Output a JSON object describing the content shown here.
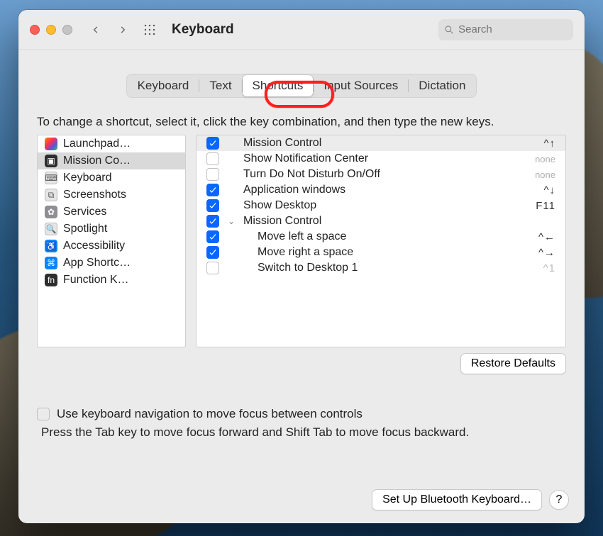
{
  "window": {
    "title": "Keyboard",
    "search_placeholder": "Search"
  },
  "tabs": [
    {
      "label": "Keyboard",
      "active": false
    },
    {
      "label": "Text",
      "active": false
    },
    {
      "label": "Shortcuts",
      "active": true,
      "highlighted": true
    },
    {
      "label": "Input Sources",
      "active": false
    },
    {
      "label": "Dictation",
      "active": false
    }
  ],
  "hint": "To change a shortcut, select it, click the key combination, and then type the new keys.",
  "categories": [
    {
      "icon": "launchpad",
      "label": "Launchpad…",
      "selected": false
    },
    {
      "icon": "mission",
      "label": "Mission Co…",
      "selected": true
    },
    {
      "icon": "keyboard",
      "label": "Keyboard",
      "selected": false
    },
    {
      "icon": "screenshots",
      "label": "Screenshots",
      "selected": false
    },
    {
      "icon": "services",
      "label": "Services",
      "selected": false
    },
    {
      "icon": "spotlight",
      "label": "Spotlight",
      "selected": false
    },
    {
      "icon": "accessibility",
      "label": "Accessibility",
      "selected": false
    },
    {
      "icon": "appshortcuts",
      "label": "App Shortc…",
      "selected": false
    },
    {
      "icon": "function",
      "label": "Function K…",
      "selected": false
    }
  ],
  "shortcuts": [
    {
      "checked": true,
      "name": "Mission Control",
      "key": "^↑",
      "header": true
    },
    {
      "checked": false,
      "name": "Show Notification Center",
      "key": "none",
      "key_none": true
    },
    {
      "checked": false,
      "name": "Turn Do Not Disturb On/Off",
      "key": "none",
      "key_none": true
    },
    {
      "checked": true,
      "name": "Application windows",
      "key": "^↓"
    },
    {
      "checked": true,
      "name": "Show Desktop",
      "key": "F11"
    },
    {
      "checked": true,
      "name": "Mission Control",
      "key": "",
      "disclosure": "open"
    },
    {
      "checked": true,
      "name": "Move left a space",
      "key": "^←",
      "indent": 1
    },
    {
      "checked": true,
      "name": "Move right a space",
      "key": "^→",
      "indent": 1
    },
    {
      "checked": false,
      "name": "Switch to Desktop 1",
      "key": "^1",
      "indent": 1,
      "key_dim": true
    }
  ],
  "buttons": {
    "restore": "Restore Defaults",
    "bluetooth": "Set Up Bluetooth Keyboard…",
    "help": "?"
  },
  "keyboard_nav": {
    "checked": false,
    "label": "Use keyboard navigation to move focus between controls",
    "note": "Press the Tab key to move focus forward and Shift Tab to move focus backward."
  }
}
